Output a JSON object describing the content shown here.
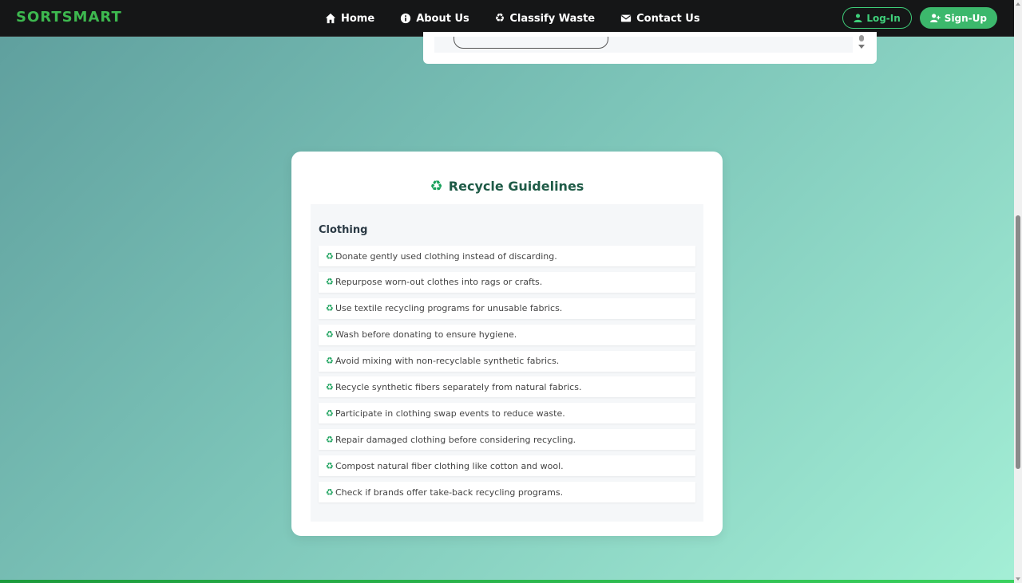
{
  "brand": "SORTSMART",
  "nav": {
    "items": [
      {
        "label": "Home",
        "icon": "home-icon"
      },
      {
        "label": "About Us",
        "icon": "info-icon"
      },
      {
        "label": "Classify Waste",
        "icon": "recycle-icon"
      },
      {
        "label": "Contact Us",
        "icon": "envelope-icon"
      }
    ],
    "login_label": "Log-In",
    "signup_label": "Sign-Up"
  },
  "guidelines": {
    "title": "Recycle Guidelines",
    "category": "Clothing",
    "items": [
      "Donate gently used clothing instead of discarding.",
      "Repurpose worn-out clothes into rags or crafts.",
      "Use textile recycling programs for unusable fabrics.",
      "Wash before donating to ensure hygiene.",
      "Avoid mixing with non-recyclable synthetic fabrics.",
      "Recycle synthetic fibers separately from natural fabrics.",
      "Participate in clothing swap events to reduce waste.",
      "Repair damaged clothing before considering recycling.",
      "Compost natural fiber clothing like cotton and wool.",
      "Check if brands offer take-back recycling programs."
    ]
  },
  "colors": {
    "brand": "#3db84f",
    "accent": "#3cb86c",
    "title": "#1f5b47",
    "navbar": "#151617"
  }
}
